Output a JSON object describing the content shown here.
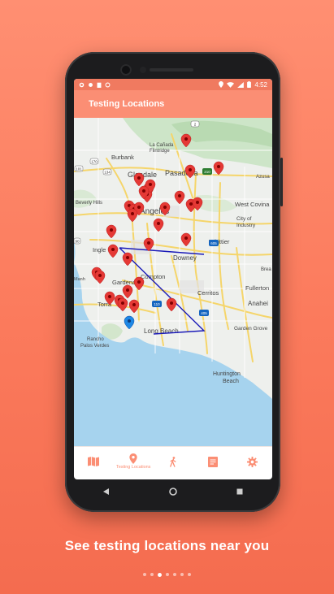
{
  "status_bar": {
    "time": "4:52"
  },
  "app_bar": {
    "title": "Testing Locations"
  },
  "map": {
    "labels": {
      "la_canada": "La Cañada",
      "flintridge": "Flintridge",
      "burbank": "Burbank",
      "glendale": "Glendale",
      "pasadena": "Pasadena",
      "azusa": "Azusa",
      "beverly_hills": "Beverly Hills",
      "los_angeles": "Angeles",
      "west_covina": "West Covina",
      "city_of_industry_1": "City of",
      "city_of_industry_2": "Industry",
      "inglewood": "Ingle",
      "downey": "Downey",
      "whittier": "Whittier",
      "compton": "Compton",
      "gardena": "Gardena",
      "manhattan_beach": "Manh",
      "cerritos": "Cerritos",
      "fullerton": "Fullerton",
      "torrance": "Torra",
      "anaheim": "Anahei",
      "long_beach": "Long Beach",
      "garden_grove": "Garden Grove",
      "rancho_palos_verdes_1": "Rancho",
      "rancho_palos_verdes_2": "Palos Verdes",
      "huntington_beach_1": "Huntington",
      "huntington_beach_2": "Beach",
      "brea": "Brea",
      "shield_2": "2",
      "shield_210": "210",
      "shield_110": "110",
      "shield_405": "405",
      "shield_605": "605",
      "shield_101": "101",
      "shield_170": "170",
      "shield_134": "134",
      "shield_90": "90"
    },
    "colors": {
      "marker": "#e53935",
      "user_marker": "#1e88e5",
      "route": "#1a1ab8"
    },
    "markers_count": 31
  },
  "bottom_nav": {
    "items": [
      {
        "icon": "map-icon",
        "label": ""
      },
      {
        "icon": "location-pin-icon",
        "label": "Testing Locations",
        "active": true
      },
      {
        "icon": "walking-person-icon",
        "label": ""
      },
      {
        "icon": "document-icon",
        "label": ""
      },
      {
        "icon": "gear-icon",
        "label": ""
      }
    ]
  },
  "caption": "See testing locations near you",
  "pager": {
    "total": 7,
    "current": 3
  },
  "accent_color": "#fb8e74"
}
